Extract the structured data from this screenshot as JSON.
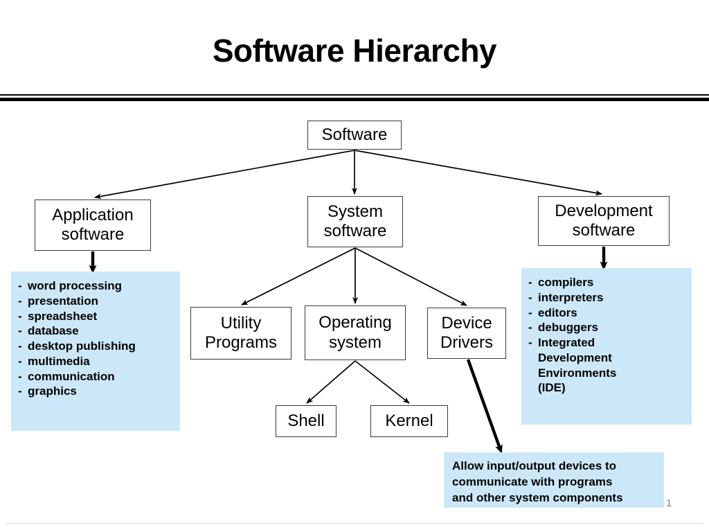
{
  "slide": {
    "title": "Software Hierarchy",
    "page_number": "1",
    "colors": {
      "callout_background": "#cce8f8",
      "box_border": "#3a3a3a",
      "text": "#000000",
      "page_number": "#808080",
      "rule": "#000000"
    }
  },
  "diagram": {
    "type": "hierarchy-tree",
    "nodes": {
      "software": "Software",
      "application_software": "Application\nsoftware",
      "system_software": "System\nsoftware",
      "development_software": "Development\nsoftware",
      "utility_programs": "Utility\nPrograms",
      "operating_system": "Operating\nsystem",
      "device_drivers": "Device\nDrivers",
      "shell": "Shell",
      "kernel": "Kernel"
    },
    "edges": [
      {
        "from": "software",
        "to": "application_software",
        "style": "thin"
      },
      {
        "from": "software",
        "to": "system_software",
        "style": "thin"
      },
      {
        "from": "software",
        "to": "development_software",
        "style": "thin"
      },
      {
        "from": "system_software",
        "to": "utility_programs",
        "style": "thin"
      },
      {
        "from": "system_software",
        "to": "operating_system",
        "style": "thin"
      },
      {
        "from": "system_software",
        "to": "device_drivers",
        "style": "thin"
      },
      {
        "from": "operating_system",
        "to": "shell",
        "style": "thin"
      },
      {
        "from": "operating_system",
        "to": "kernel",
        "style": "thin"
      },
      {
        "from": "application_software",
        "to": "application_examples",
        "style": "thick"
      },
      {
        "from": "development_software",
        "to": "development_examples",
        "style": "thick"
      },
      {
        "from": "device_drivers",
        "to": "device_note",
        "style": "thick"
      }
    ]
  },
  "callouts": {
    "application_examples": {
      "dash": "-",
      "items": [
        "word processing",
        "presentation",
        "spreadsheet",
        "database",
        "desktop publishing",
        "multimedia",
        "communication",
        "graphics"
      ]
    },
    "development_examples": {
      "dash": "-",
      "items": [
        "compilers",
        "interpreters",
        "editors",
        "debuggers",
        "Integrated\nDevelopment\nEnvironments\n(IDE)"
      ]
    },
    "device_note": {
      "lines": [
        "Allow input/output devices to",
        "communicate with programs",
        "and other system components"
      ]
    }
  }
}
